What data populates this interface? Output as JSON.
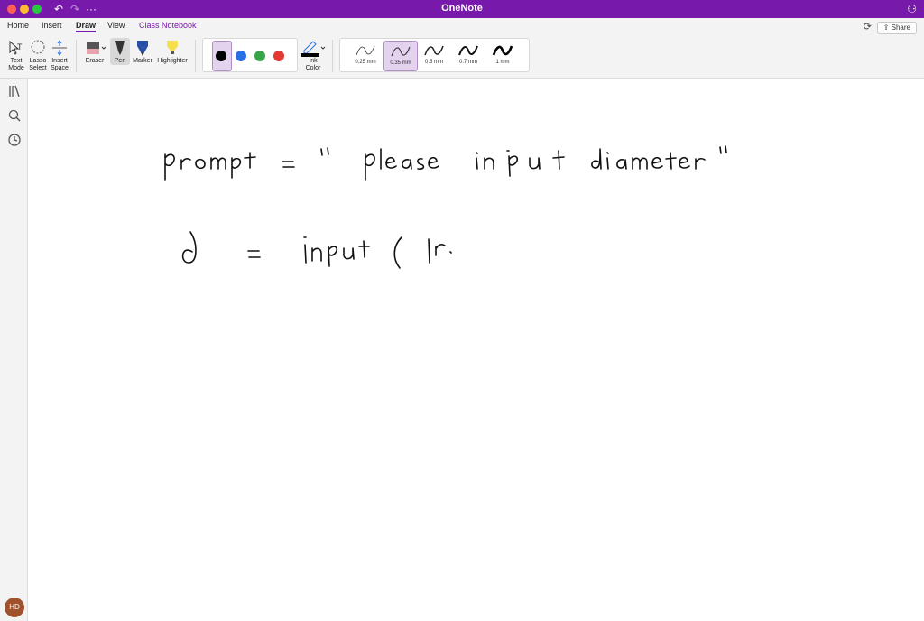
{
  "window": {
    "title": "OneNote"
  },
  "menu": {
    "tabs": [
      {
        "label": "Home"
      },
      {
        "label": "Insert"
      },
      {
        "label": "Draw"
      },
      {
        "label": "View"
      },
      {
        "label": "Class Notebook"
      }
    ],
    "active_tab": "Draw",
    "share_label": "Share"
  },
  "ribbon": {
    "text_mode": {
      "line1": "Text",
      "line2": "Mode"
    },
    "lasso_select": {
      "line1": "Lasso",
      "line2": "Select"
    },
    "insert_space": {
      "line1": "Insert",
      "line2": "Space"
    },
    "eraser": "Eraser",
    "pen": "Pen",
    "marker": "Marker",
    "highlighter": "Highlighter",
    "ink_color": {
      "line1": "Ink",
      "line2": "Color"
    },
    "colors": [
      "#000000",
      "#2b6fe6",
      "#36a54a",
      "#e23b35"
    ],
    "selected_color": "#000000",
    "thickness": [
      {
        "label": "0.25 mm"
      },
      {
        "label": "0.35 mm"
      },
      {
        "label": "0.5 mm"
      },
      {
        "label": "0.7 mm"
      },
      {
        "label": "1 mm"
      }
    ],
    "selected_thickness": "0.35 mm"
  },
  "sidebar": {
    "icons": [
      "notebooks-icon",
      "search-icon",
      "recent-icon"
    ],
    "avatar_initials": "HD"
  },
  "note": {
    "handwriting": [
      "prompt = '' please input diameter ''",
      "d = input ( ln"
    ]
  },
  "theme": {
    "accent": "#7719aa"
  }
}
